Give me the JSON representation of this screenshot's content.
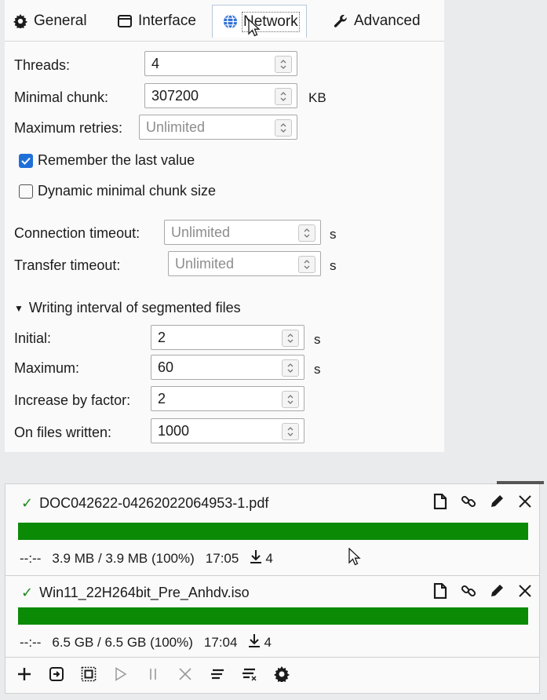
{
  "tabs": [
    {
      "label": "General",
      "icon": "gear-icon"
    },
    {
      "label": "Interface",
      "icon": "window-icon"
    },
    {
      "label": "Network",
      "icon": "globe-icon",
      "active": true
    },
    {
      "label": "Advanced",
      "icon": "wrench-icon"
    }
  ],
  "network": {
    "threads": {
      "label": "Threads:",
      "value": "4"
    },
    "min_chunk": {
      "label": "Minimal chunk:",
      "value": "307200",
      "unit": "KB"
    },
    "max_retries": {
      "label": "Maximum retries:",
      "placeholder": "Unlimited"
    },
    "remember_last": {
      "label": "Remember the last value",
      "checked": true
    },
    "dynamic_chunk": {
      "label": "Dynamic minimal chunk size",
      "checked": false
    },
    "connection_timeout": {
      "label": "Connection timeout:",
      "placeholder": "Unlimited",
      "unit": "s"
    },
    "transfer_timeout": {
      "label": "Transfer timeout:",
      "placeholder": "Unlimited",
      "unit": "s"
    },
    "writing_section": {
      "label": "Writing interval of segmented files",
      "expanded": true
    },
    "initial": {
      "label": "Initial:",
      "value": "2",
      "unit": "s"
    },
    "maximum": {
      "label": "Maximum:",
      "value": "60",
      "unit": "s"
    },
    "factor": {
      "label": "Increase by factor:",
      "value": "2"
    },
    "files_written": {
      "label": "On files written:",
      "value": "1000"
    }
  },
  "downloads": [
    {
      "name": "DOC042622-04262022064953-1.pdf",
      "progress": 1.0,
      "eta": "--:--",
      "size": "3.9 MB / 3.9 MB (100%)",
      "time": "17:05",
      "connections": "4"
    },
    {
      "name": "Win11_22H264bit_Pre_Anhdv.iso",
      "progress": 1.0,
      "eta": "--:--",
      "size": "6.5 GB / 6.5 GB (100%)",
      "time": "17:04",
      "connections": "4"
    }
  ],
  "colors": {
    "progress": "#0b8a06",
    "check_accent": "#1f6fd8",
    "done_mark": "#1a8a1a"
  }
}
